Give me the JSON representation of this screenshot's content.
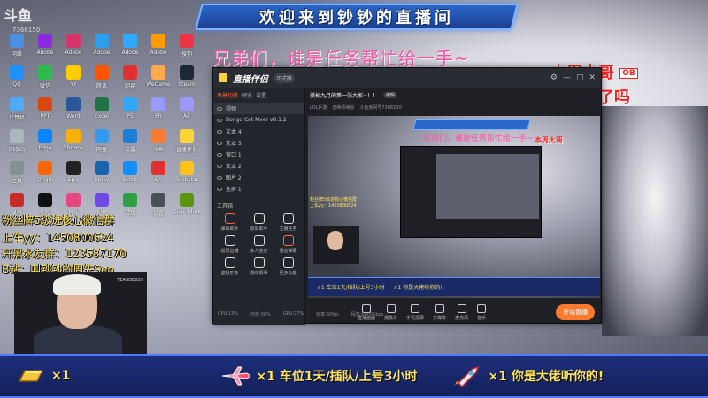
{
  "platform": {
    "logo": "斗鱼",
    "room_id": "7366150"
  },
  "banner": {
    "text": "欢迎来到钞钞的直播间"
  },
  "overlays": {
    "pink_text": "兄弟们，谁是任务帮忙给一手~",
    "red_text_line1": "本周大哥",
    "red_badge": "OB",
    "red_text_line2": "演上的了吗",
    "fan_lines": [
      "粉丝牌5级进核心微信群",
      "上车yy：1450800624",
      "开黑水友群：123587170",
      "B站：叫钞钞的周先Sen"
    ]
  },
  "cam": {
    "tag": "TEA3DEB33"
  },
  "desktop_icons": [
    {
      "label": "网络",
      "color": "#4a90e2"
    },
    {
      "label": "Adobe",
      "color": "#8a2be2"
    },
    {
      "label": "Adobe",
      "color": "#d6336c"
    },
    {
      "label": "Adobe",
      "color": "#2ca0f0"
    },
    {
      "label": "Adobe",
      "color": "#31a8ff"
    },
    {
      "label": "Adobe",
      "color": "#ff9a00"
    },
    {
      "label": "搜狗",
      "color": "#ee3344"
    },
    {
      "label": "QQ",
      "color": "#1e90ff"
    },
    {
      "label": "微信",
      "color": "#2dbb4e"
    },
    {
      "label": "YY",
      "color": "#ffcc00"
    },
    {
      "label": "腾讯",
      "color": "#ff5500"
    },
    {
      "label": "网易",
      "color": "#e03131"
    },
    {
      "label": "WeGame",
      "color": "#ffa94d"
    },
    {
      "label": "Steam",
      "color": "#1b2838"
    },
    {
      "label": "计算机",
      "color": "#4dabf7"
    },
    {
      "label": "PPT",
      "color": "#d9480f"
    },
    {
      "label": "Word",
      "color": "#2b579a"
    },
    {
      "label": "Excel",
      "color": "#217346"
    },
    {
      "label": "PS",
      "color": "#31a8ff"
    },
    {
      "label": "PR",
      "color": "#9999ff"
    },
    {
      "label": "AE",
      "color": "#9999ff"
    },
    {
      "label": "回收站",
      "color": "#adb5bd"
    },
    {
      "label": "Edge",
      "color": "#0a84ff"
    },
    {
      "label": "Chrome",
      "color": "#fab005"
    },
    {
      "label": "网盘",
      "color": "#339af0"
    },
    {
      "label": "迅雷",
      "color": "#1c7ed6"
    },
    {
      "label": "斗鱼",
      "color": "#ff7a2f"
    },
    {
      "label": "直播伴侣",
      "color": "#ffd43b"
    },
    {
      "label": "工具",
      "color": "#868e96"
    },
    {
      "label": "Origin",
      "color": "#f76707"
    },
    {
      "label": "Epic",
      "color": "#222"
    },
    {
      "label": "Uplay",
      "color": "#1864ab"
    },
    {
      "label": "Battle",
      "color": "#148eff"
    },
    {
      "label": "EA",
      "color": "#e03131"
    },
    {
      "label": "Rockstar",
      "color": "#fcc419"
    },
    {
      "label": "录屏",
      "color": "#c92a2a"
    },
    {
      "label": "剪映",
      "color": "#111"
    },
    {
      "label": "音乐",
      "color": "#e64980"
    },
    {
      "label": "视频",
      "color": "#7048e8"
    },
    {
      "label": "游戏",
      "color": "#2f9e44"
    },
    {
      "label": "设置",
      "color": "#495057"
    },
    {
      "label": "Stronghold",
      "color": "#5c940d"
    }
  ],
  "app": {
    "name": "直播伴侣",
    "badge": "正式版",
    "tabs": [
      "场景切换",
      "预览",
      "设置"
    ],
    "active_tab": "场景切换",
    "scenes": [
      "视频",
      "Bongo Cat Mver v0.1.2",
      "文本 4",
      "文本 3",
      "窗口 1",
      "文本 2",
      "图片 2",
      "全屏 1"
    ],
    "tools_label": "工具箱",
    "tools": [
      "弹幕助手",
      "录屏助手",
      "主播任务",
      "投屏直播",
      "多人连麦",
      "语音弹幕",
      "虚拟形象",
      "游戏赛事",
      "更多功能"
    ],
    "room_title": "撕掉九月的第一张大家~！！",
    "room_tag": "编辑",
    "room_sub": [
      "LOL手游",
      "召唤师峡谷",
      "斗鱼房间号7366150"
    ],
    "bottom_buttons": [
      "直播画面",
      "摄像头",
      "手机投屏",
      "多媒体",
      "麦克风",
      "音乐"
    ],
    "live_button": "开始直播",
    "status_items": [
      "CPU:13%",
      "内存:36%",
      "GPU:27%",
      "帧率:60fps",
      "码率:6000Kbps"
    ]
  },
  "preview_gift_items": [
    "×1 车位1天/插队/上号3小时",
    "×1 你是大佬听你的!"
  ],
  "gifts": [
    {
      "icon": "gold-bar-icon",
      "text": "×1"
    },
    {
      "icon": "plane-icon",
      "text": "×1  车位1天/插队/上号3小时"
    },
    {
      "icon": "rocket-icon",
      "text": "×1  你是大佬听你的!"
    }
  ]
}
